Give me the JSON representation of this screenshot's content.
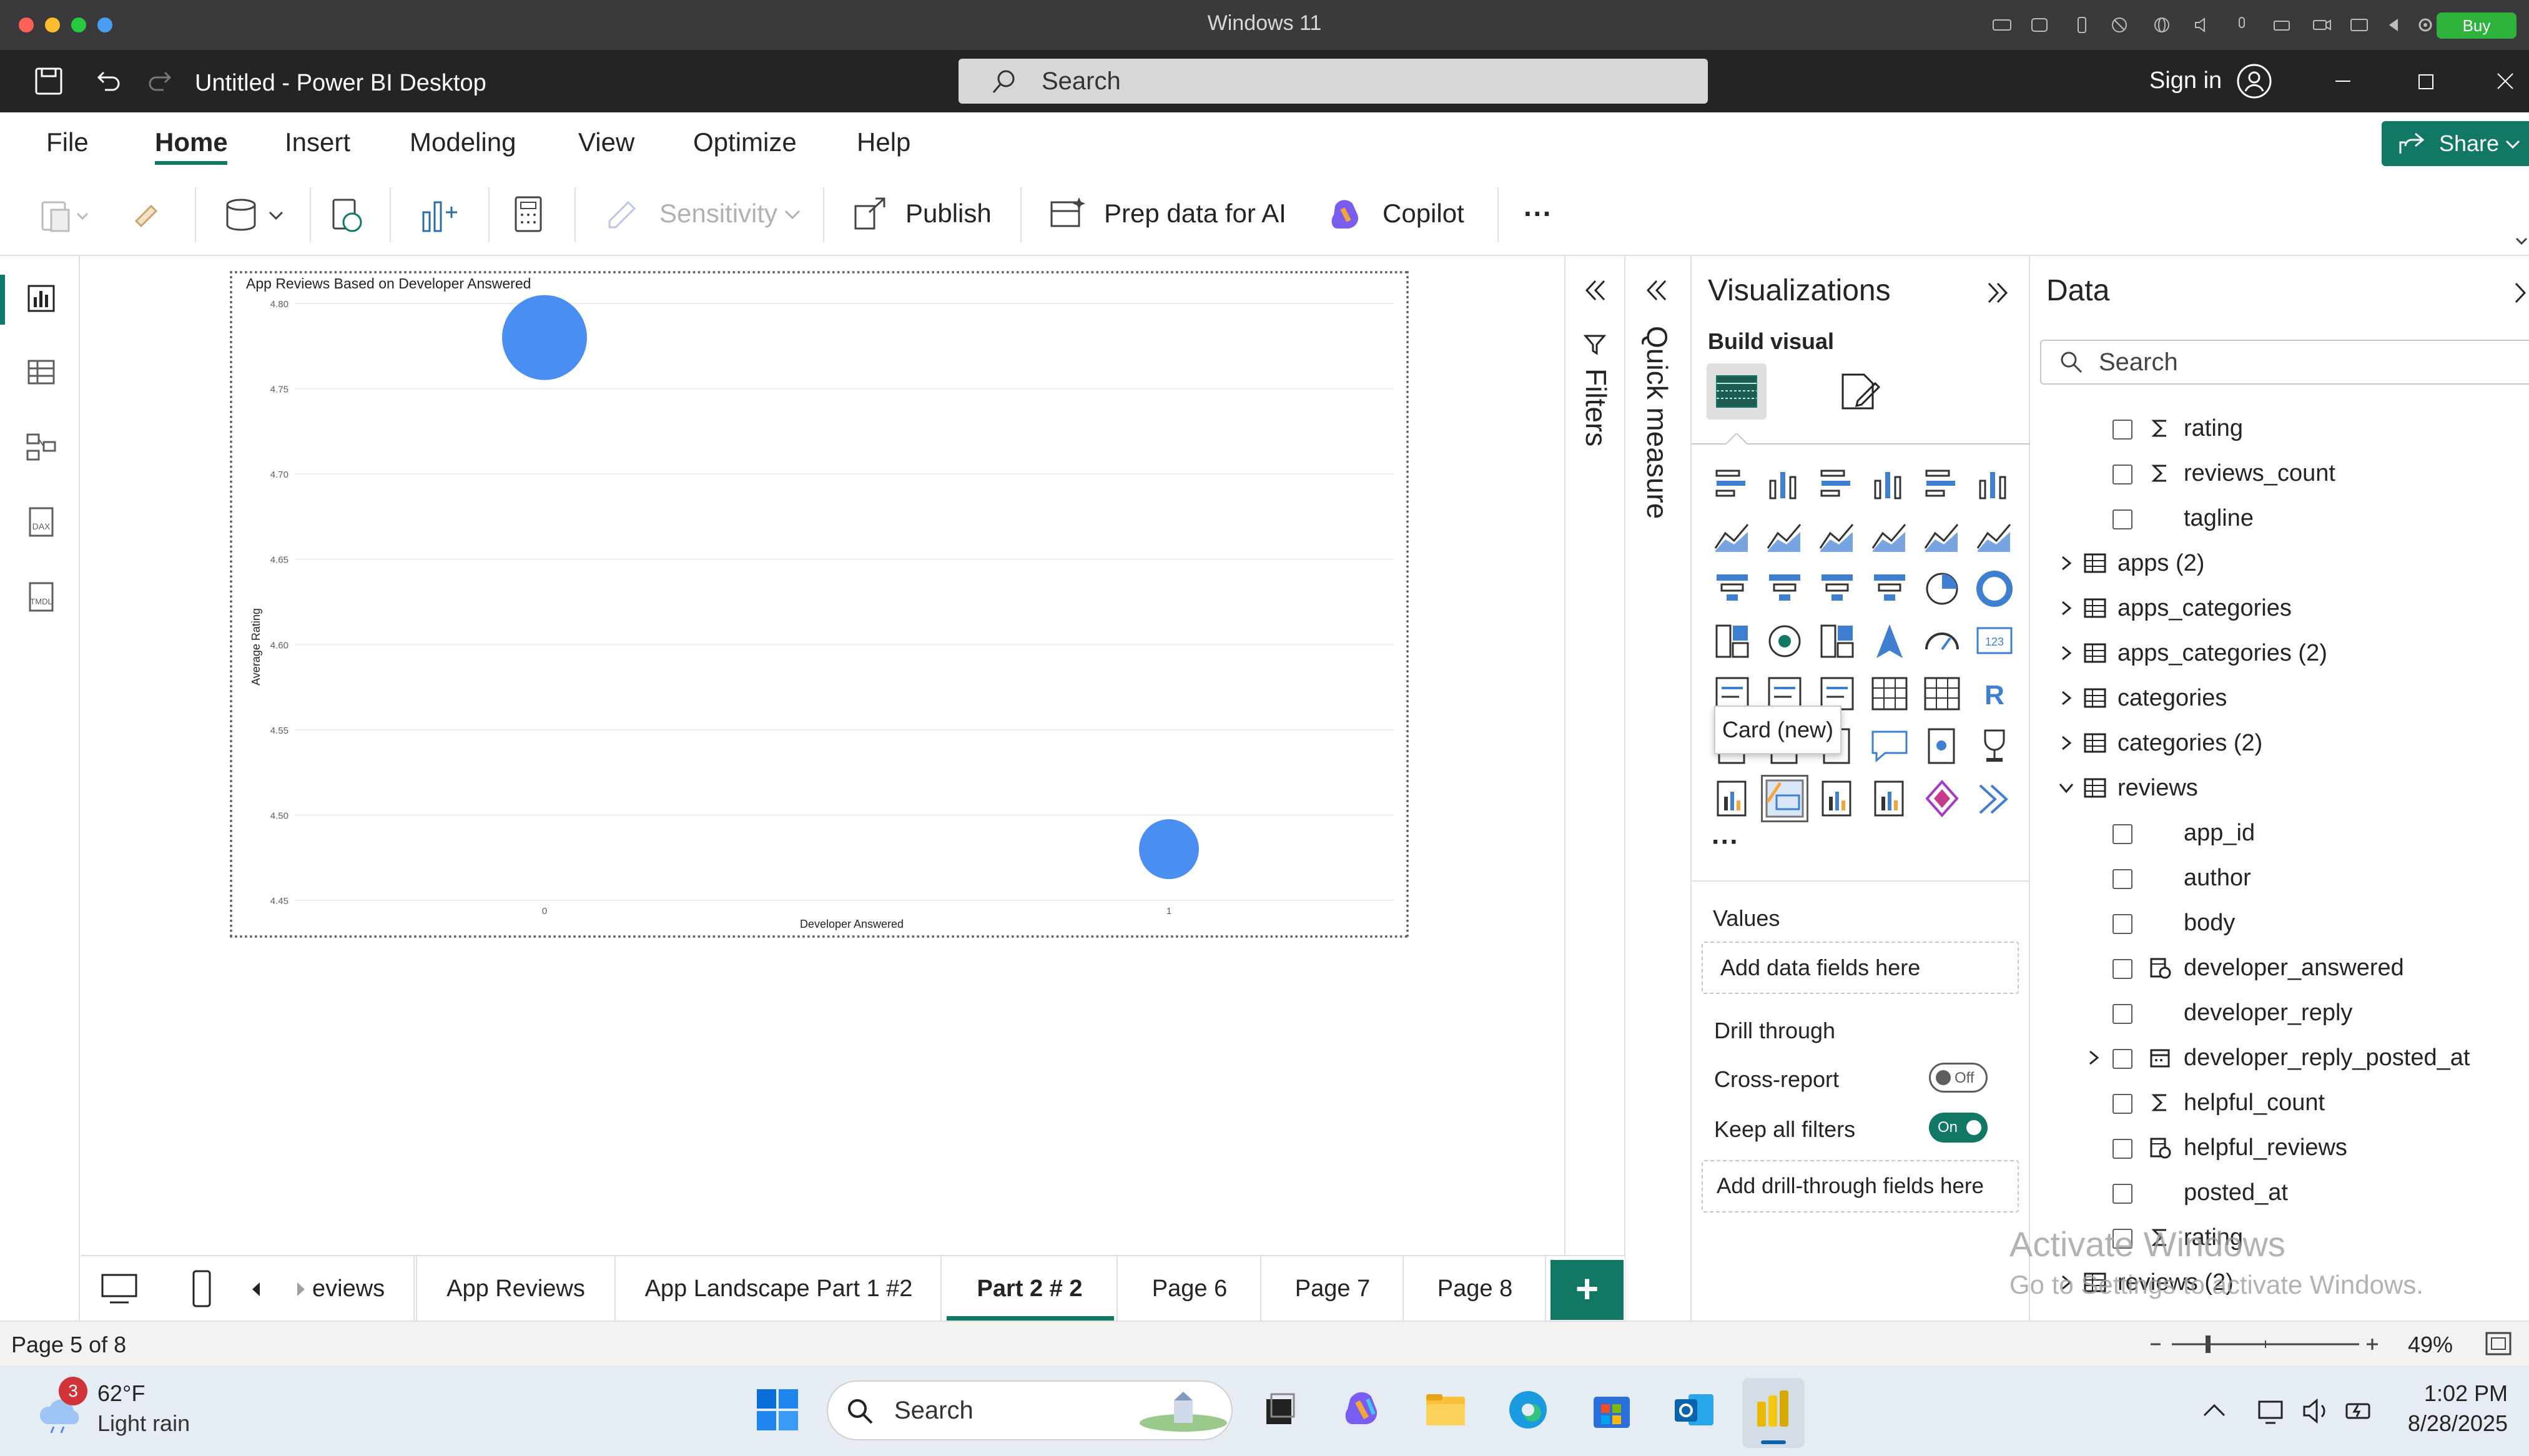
{
  "mac": {
    "title": "Windows 11",
    "buy": "Buy"
  },
  "titlebar": {
    "title": "Untitled - Power BI Desktop",
    "search_placeholder": "Search",
    "signin": "Sign in"
  },
  "menu": {
    "items": [
      "File",
      "Home",
      "Insert",
      "Modeling",
      "View",
      "Optimize",
      "Help"
    ],
    "share": "Share"
  },
  "ribbon": {
    "sensitivity": "Sensitivity",
    "publish": "Publish",
    "prep": "Prep data for AI",
    "copilot": "Copilot",
    "more": "···"
  },
  "chart_data": {
    "type": "scatter",
    "title": "App Reviews Based on Developer Answered",
    "xlabel": "Developer Answered",
    "ylabel": "Average Rating",
    "x_ticks": [
      "0",
      "1"
    ],
    "y_ticks": [
      "4.80",
      "4.75",
      "4.70",
      "4.65",
      "4.60",
      "4.55",
      "4.50",
      "4.45"
    ],
    "ylim": [
      4.45,
      4.8
    ],
    "points": [
      {
        "x": 0,
        "y": 4.78,
        "size": "large"
      },
      {
        "x": 1,
        "y": 4.48,
        "size": "small"
      }
    ],
    "color": "#4a8ef2",
    "grid": true
  },
  "filters": {
    "label": "Filters",
    "quick_measure": "Quick measure"
  },
  "viz": {
    "title": "Visualizations",
    "build_visual": "Build visual",
    "tooltip": "Card (new)",
    "more": "···",
    "values_label": "Values",
    "values_placeholder": "Add data fields here",
    "drill_through": "Drill through",
    "cross_report": "Cross-report",
    "cross_state": "Off",
    "keep_filters": "Keep all filters",
    "keep_state": "On",
    "drill_placeholder": "Add drill-through fields here"
  },
  "data": {
    "title": "Data",
    "search_placeholder": "Search",
    "rows": [
      {
        "label": "rating",
        "kind": "field",
        "icon": "sigma"
      },
      {
        "label": "reviews_count",
        "kind": "field",
        "icon": "sigma"
      },
      {
        "label": "tagline",
        "kind": "field",
        "icon": "none"
      },
      {
        "label": "apps (2)",
        "kind": "table",
        "expanded": false
      },
      {
        "label": "apps_categories",
        "kind": "table",
        "expanded": false
      },
      {
        "label": "apps_categories (2)",
        "kind": "table",
        "expanded": false
      },
      {
        "label": "categories",
        "kind": "table",
        "expanded": false
      },
      {
        "label": "categories (2)",
        "kind": "table",
        "expanded": false
      },
      {
        "label": "reviews",
        "kind": "table",
        "expanded": true
      },
      {
        "label": "app_id",
        "kind": "field",
        "icon": "none"
      },
      {
        "label": "author",
        "kind": "field",
        "icon": "none"
      },
      {
        "label": "body",
        "kind": "field",
        "icon": "none"
      },
      {
        "label": "developer_answered",
        "kind": "field",
        "icon": "calc"
      },
      {
        "label": "developer_reply",
        "kind": "field",
        "icon": "none"
      },
      {
        "label": "developer_reply_posted_at",
        "kind": "field",
        "icon": "calendar",
        "expandable": true
      },
      {
        "label": "helpful_count",
        "kind": "field",
        "icon": "sigma"
      },
      {
        "label": "helpful_reviews",
        "kind": "field",
        "icon": "calc"
      },
      {
        "label": "posted_at",
        "kind": "field",
        "icon": "none"
      },
      {
        "label": "rating",
        "kind": "field",
        "icon": "sigma"
      },
      {
        "label": "reviews (2)",
        "kind": "table",
        "expanded": false
      }
    ]
  },
  "watermark": {
    "line1": "Activate Windows",
    "line2": "Go to Settings to activate Windows."
  },
  "tabs": {
    "items": [
      "eviews",
      "App Reviews",
      "App Landscape Part 1 #2",
      "Part 2 # 2",
      "Page 6",
      "Page 7",
      "Page 8"
    ],
    "active": "Part 2 # 2",
    "add": "+"
  },
  "status": {
    "page": "Page 5 of 8",
    "zoom": "49%"
  },
  "taskbar": {
    "weather_badge": "3",
    "temp": "62°F",
    "weather": "Light rain",
    "search": "Search",
    "time": "1:02 PM",
    "date": "8/28/2025"
  },
  "colors": {
    "accent": "#117865",
    "bubble": "#4a8ef2"
  }
}
